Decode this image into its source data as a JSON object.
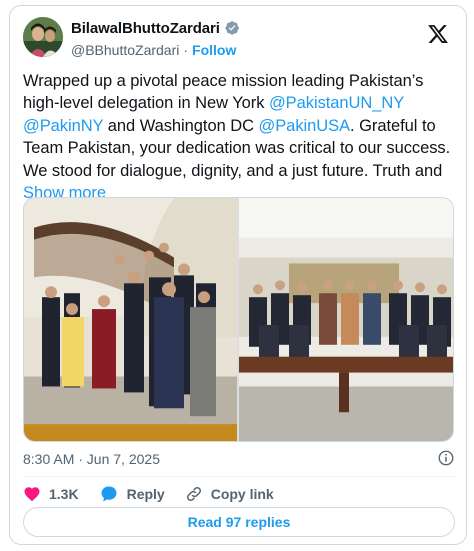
{
  "author": {
    "name": "BilawalBhuttoZardari",
    "handle": "@BBhuttoZardari",
    "separator": "·",
    "follow_label": "Follow"
  },
  "tweet": {
    "text_parts": [
      {
        "type": "text",
        "value": "Wrapped up a pivotal peace mission leading Pakistan’s high-level delegation in New York "
      },
      {
        "type": "mention",
        "value": "@PakistanUN_NY"
      },
      {
        "type": "text",
        "value": " "
      },
      {
        "type": "mention",
        "value": "@PakinNY"
      },
      {
        "type": "text",
        "value": " and Washington DC "
      },
      {
        "type": "mention",
        "value": "@PakinUSA"
      },
      {
        "type": "text",
        "value": ". Grateful to Team Pakistan, your dedication was critical to our success. We stood for dialogue, dignity, and a just future. Truth and "
      }
    ],
    "show_more_label": "Show more",
    "timestamp": "8:30 AM · Jun 7, 2025"
  },
  "actions": {
    "likes_count": "1.3K",
    "reply_label": "Reply",
    "copy_link_label": "Copy link"
  },
  "read_replies_label": "Read 97 replies",
  "colors": {
    "accent": "#1d9bf0",
    "like": "#f91880",
    "muted_text": "#536471",
    "border": "#cfd9de"
  },
  "icons": {
    "verified": "verified-badge-icon",
    "brand": "x-logo-icon",
    "info": "info-icon",
    "like": "heart-icon",
    "reply": "speech-bubble-icon",
    "copy_link": "link-icon"
  }
}
